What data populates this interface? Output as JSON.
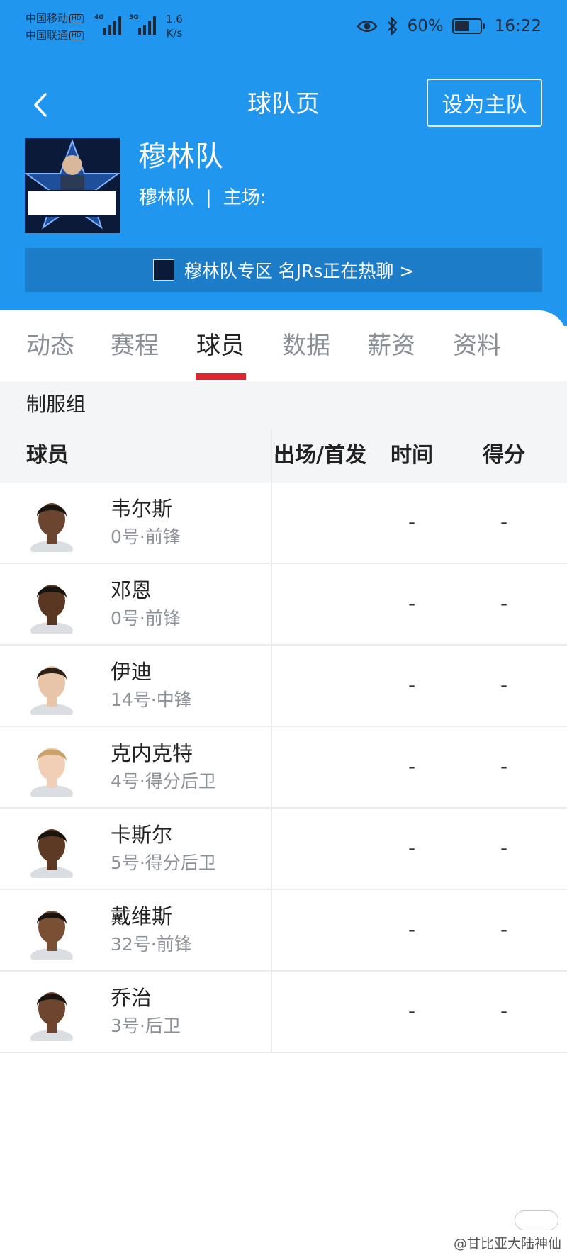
{
  "status_bar": {
    "carrier1": "中国移动",
    "carrier2": "中国联通",
    "hd": "HD",
    "net1": "4G",
    "net2": "5G",
    "speed_value": "1.6",
    "speed_unit": "K/s",
    "battery_percent": "60%",
    "battery_level": 0.6,
    "time": "16:22"
  },
  "header": {
    "title": "球队页",
    "set_home_label": "设为主队",
    "team_name": "穆林队",
    "team_short": "穆林队",
    "home_venue_label": "主场:",
    "separator": "|",
    "banner_text": "穆林队专区 名JRs正在热聊 >"
  },
  "tabs": [
    {
      "label": "动态"
    },
    {
      "label": "赛程"
    },
    {
      "label": "球员"
    },
    {
      "label": "数据"
    },
    {
      "label": "薪资"
    },
    {
      "label": "资料"
    }
  ],
  "active_tab": "球员",
  "table": {
    "group_title": "制服组",
    "columns": {
      "player": "球员",
      "apps": "出场/首发",
      "time": "时间",
      "points": "得分"
    },
    "rows": [
      {
        "name": "韦尔斯",
        "info": "0号·前锋",
        "apps": "",
        "time": "-",
        "points": "-"
      },
      {
        "name": "邓恩",
        "info": "0号·前锋",
        "apps": "",
        "time": "-",
        "points": "-"
      },
      {
        "name": "伊迪",
        "info": "14号·中锋",
        "apps": "",
        "time": "-",
        "points": "-"
      },
      {
        "name": "克内克特",
        "info": "4号·得分后卫",
        "apps": "",
        "time": "-",
        "points": "-"
      },
      {
        "name": "卡斯尔",
        "info": "5号·得分后卫",
        "apps": "",
        "time": "-",
        "points": "-"
      },
      {
        "name": "戴维斯",
        "info": "32号·前锋",
        "apps": "",
        "time": "-",
        "points": "-"
      },
      {
        "name": "乔治",
        "info": "3号·后卫",
        "apps": "",
        "time": "-",
        "points": "-"
      }
    ]
  },
  "watermark": "@甘比亚大陆神仙",
  "colors": {
    "header_bg": "#2196ef",
    "banner_bg": "#1c7cc8",
    "tab_indicator": "#e1252f",
    "table_header_bg": "#f4f5f7"
  }
}
